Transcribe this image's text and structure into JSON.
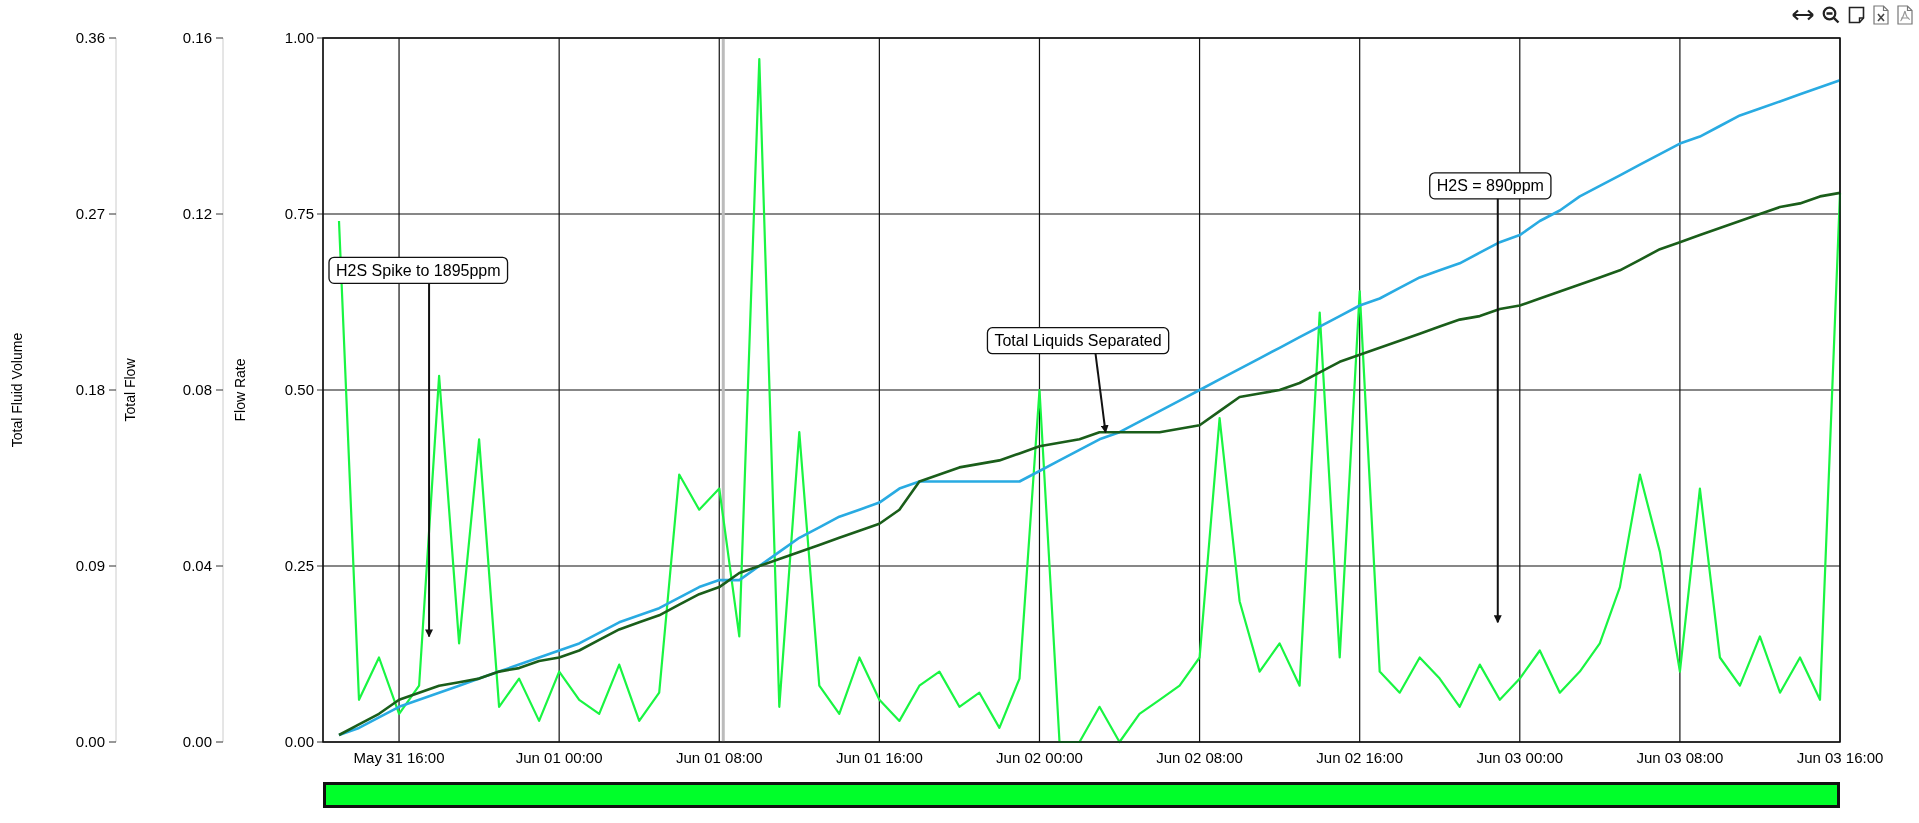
{
  "chart": {
    "left_axes": [
      {
        "title": "Total Fluid Volume",
        "ticks": [
          "0.36",
          "0.27",
          "0.18",
          "0.09",
          "0.00"
        ]
      },
      {
        "title": "Total Flow",
        "ticks": [
          "0.16",
          "0.12",
          "0.08",
          "0.04",
          "0.00"
        ]
      }
    ],
    "chart_data": {
      "type": "line",
      "ylabel": "Flow Rate",
      "categories": [
        null,
        null,
        null,
        "May 31 16:00",
        null,
        null,
        null,
        null,
        null,
        null,
        null,
        "Jun 01 00:00",
        null,
        null,
        null,
        null,
        null,
        null,
        null,
        "Jun 01 08:00",
        null,
        null,
        null,
        null,
        null,
        null,
        null,
        "Jun 01 16:00",
        null,
        null,
        null,
        null,
        null,
        null,
        null,
        "Jun 02 00:00",
        null,
        null,
        null,
        null,
        null,
        null,
        null,
        "Jun 02 08:00",
        null,
        null,
        null,
        null,
        null,
        null,
        null,
        "Jun 02 16:00",
        null,
        null,
        null,
        null,
        null,
        null,
        null,
        "Jun 03 00:00",
        null,
        null,
        null,
        null,
        null,
        null,
        null,
        "Jun 03 08:00",
        null,
        null,
        null,
        null,
        null,
        null,
        null,
        "Jun 03 16:00"
      ],
      "ylim": [
        0,
        1
      ],
      "grid": true,
      "yticks": [
        {
          "value": 0,
          "label": "0.00"
        },
        {
          "value": 0.25,
          "label": "0.25"
        },
        {
          "value": 0.5,
          "label": "0.50"
        },
        {
          "value": 0.75,
          "label": "0.75"
        },
        {
          "value": 1,
          "label": "1.00"
        }
      ],
      "series": [
        {
          "color": "#19f542",
          "values": [
            0.74,
            0.06,
            0.12,
            0.04,
            0.08,
            0.52,
            0.14,
            0.43,
            0.05,
            0.09,
            0.03,
            0.1,
            0.06,
            0.04,
            0.11,
            0.03,
            0.07,
            0.38,
            0.33,
            0.36,
            0.15,
            0.97,
            0.05,
            0.44,
            0.08,
            0.04,
            0.12,
            0.06,
            0.03,
            0.08,
            0.1,
            0.05,
            0.07,
            0.02,
            0.09,
            0.5,
            0,
            0,
            0.05,
            0,
            0.04,
            0.06,
            0.08,
            0.12,
            0.46,
            0.2,
            0.1,
            0.14,
            0.08,
            0.61,
            0.12,
            0.64,
            0.1,
            0.07,
            0.12,
            0.09,
            0.05,
            0.11,
            0.06,
            0.09,
            0.13,
            0.07,
            0.1,
            0.14,
            0.22,
            0.38,
            0.27,
            0.1,
            0.36,
            0.12,
            0.08,
            0.15,
            0.07,
            0.12,
            0.06,
            0.78
          ]
        },
        {
          "color": "#29abe2",
          "values": [
            0.01,
            0.02,
            0.035,
            0.05,
            0.06,
            0.07,
            0.08,
            0.09,
            0.1,
            0.11,
            0.12,
            0.13,
            0.14,
            0.155,
            0.17,
            0.18,
            0.19,
            0.205,
            0.22,
            0.23,
            0.23,
            0.25,
            0.27,
            0.29,
            0.305,
            0.32,
            0.33,
            0.34,
            0.36,
            0.37,
            0.37,
            0.37,
            0.37,
            0.37,
            0.37,
            0.385,
            0.4,
            0.415,
            0.43,
            0.44,
            0.455,
            0.47,
            0.485,
            0.5,
            0.515,
            0.53,
            0.545,
            0.56,
            0.575,
            0.59,
            0.605,
            0.62,
            0.63,
            0.645,
            0.66,
            0.67,
            0.68,
            0.695,
            0.71,
            0.72,
            0.74,
            0.755,
            0.775,
            0.79,
            0.805,
            0.82,
            0.835,
            0.85,
            0.86,
            0.875,
            0.89,
            0.9,
            0.91,
            0.92,
            0.93,
            0.94
          ]
        },
        {
          "color": "#1a5e1a",
          "values": [
            0.01,
            0.025,
            0.04,
            0.06,
            0.07,
            0.08,
            0.085,
            0.09,
            0.1,
            0.105,
            0.115,
            0.12,
            0.13,
            0.145,
            0.16,
            0.17,
            0.18,
            0.195,
            0.21,
            0.22,
            0.24,
            0.25,
            0.26,
            0.27,
            0.28,
            0.29,
            0.3,
            0.31,
            0.33,
            0.37,
            0.38,
            0.39,
            0.395,
            0.4,
            0.41,
            0.42,
            0.425,
            0.43,
            0.44,
            0.44,
            0.44,
            0.44,
            0.445,
            0.45,
            0.47,
            0.49,
            0.495,
            0.5,
            0.51,
            0.525,
            0.54,
            0.55,
            0.56,
            0.57,
            0.58,
            0.59,
            0.6,
            0.605,
            0.615,
            0.62,
            0.63,
            0.64,
            0.65,
            0.66,
            0.67,
            0.685,
            0.7,
            0.71,
            0.72,
            0.73,
            0.74,
            0.75,
            0.76,
            0.765,
            0.775,
            0.78
          ]
        }
      ],
      "annotations": [
        "H2S Spike to 1895ppm",
        "Total Liquids Separated",
        "H2S = 890ppm"
      ]
    }
  }
}
